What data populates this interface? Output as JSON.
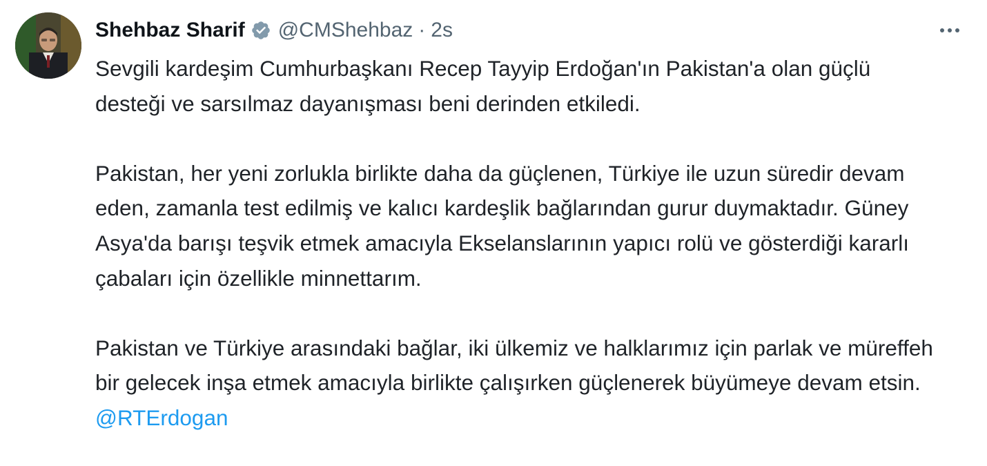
{
  "tweet": {
    "author": {
      "name": "Shehbaz Sharif",
      "handle": "@CMShehbaz",
      "separator": "·",
      "time": "2s",
      "verified_color": "#829aab"
    },
    "more_icon": "more-horizontal-icon",
    "paragraphs": [
      "Sevgili kardeşim Cumhurbaşkanı Recep Tayyip Erdoğan'ın Pakistan'a olan güçlü desteği ve sarsılmaz dayanışması beni derinden etkiledi.",
      "Pakistan, her yeni zorlukla birlikte daha da güçlenen, Türkiye ile uzun süredir devam eden, zamanla test edilmiş ve kalıcı kardeşlik bağlarından gurur duymaktadır. Güney Asya'da barışı teşvik etmek amacıyla Ekselanslarının yapıcı rolü ve gösterdiği kararlı çabaları için özellikle minnettarım.",
      "Pakistan ve Türkiye arasındaki bağlar, iki ülkemiz ve halklarımız için parlak ve müreffeh bir gelecek inşa etmek amacıyla birlikte çalışırken güçlenerek büyümeye devam etsin."
    ],
    "mention": "@RTErdogan",
    "colors": {
      "mention": "#1d9bf0",
      "text": "#1f2328",
      "secondary": "#536471"
    }
  }
}
